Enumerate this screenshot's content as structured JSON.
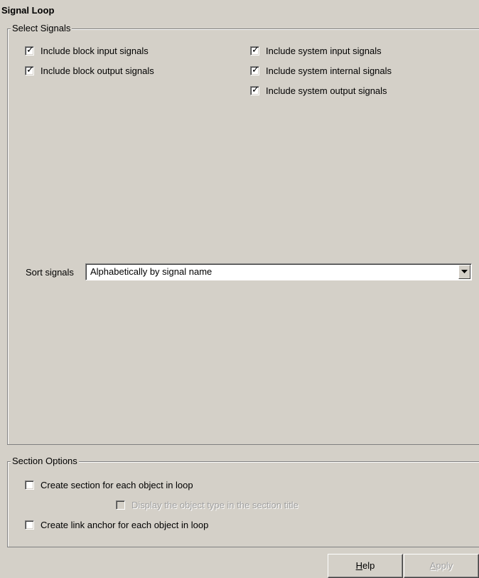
{
  "panel": {
    "title": "Signal Loop"
  },
  "select_signals": {
    "legend": "Select Signals",
    "block_input": {
      "label": "Include block input signals",
      "checked": true
    },
    "block_output": {
      "label": "Include block output signals",
      "checked": true
    },
    "system_input": {
      "label": "Include system input signals",
      "checked": true
    },
    "system_internal": {
      "label": "Include system internal signals",
      "checked": true
    },
    "system_output": {
      "label": "Include system output signals",
      "checked": true
    },
    "sort_label": "Sort signals",
    "sort_value": "Alphabetically by signal name"
  },
  "section_options": {
    "legend": "Section Options",
    "create_section": {
      "label": "Create section for each object in loop",
      "checked": false
    },
    "display_type": {
      "label": "Display the object type in the section title",
      "checked": false,
      "disabled": true
    },
    "create_anchor": {
      "label": "Create link anchor for each object in loop",
      "checked": false
    }
  },
  "buttons": {
    "help": "Help",
    "apply": "Apply"
  },
  "icons": {
    "check": "check-mark-icon",
    "dropdown": "dropdown-arrow-icon"
  }
}
